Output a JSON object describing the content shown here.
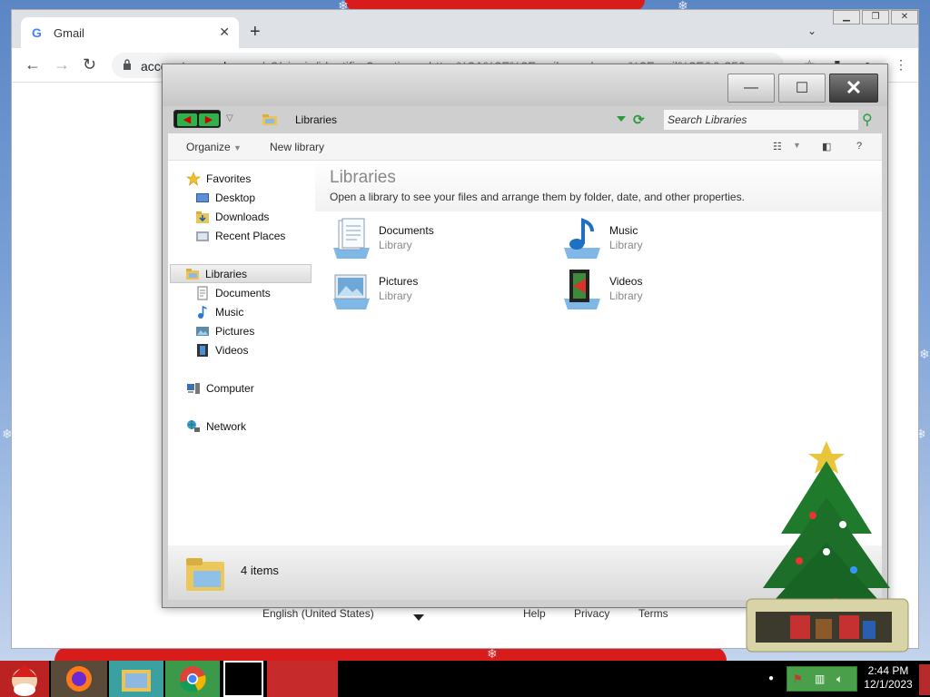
{
  "browser": {
    "tab_title": "Gmail",
    "tab_close": "✕",
    "new_tab": "+",
    "url_host": "accounts.google.com",
    "url_rest": "/v3/signin/identifier?continue=https%3A%2F%2Fmail.google.com%2Fmail%2F&&.250",
    "footer": {
      "language": "English (United States)",
      "help": "Help",
      "privacy": "Privacy",
      "terms": "Terms"
    }
  },
  "explorer": {
    "address": "Libraries",
    "search_placeholder": "Search Libraries",
    "commands": {
      "organize": "Organize",
      "new_library": "New library",
      "help": "?"
    },
    "nav": {
      "favorites": "Favorites",
      "desktop": "Desktop",
      "downloads": "Downloads",
      "recent": "Recent Places",
      "libraries": "Libraries",
      "documents": "Documents",
      "music": "Music",
      "pictures": "Pictures",
      "videos": "Videos",
      "computer": "Computer",
      "network": "Network"
    },
    "header": {
      "title": "Libraries",
      "description": "Open a library to see your files and arrange them by folder, date, and other properties."
    },
    "libraries": [
      {
        "name": "Documents",
        "type": "Library",
        "icon": "documents-library-icon"
      },
      {
        "name": "Music",
        "type": "Library",
        "icon": "music-library-icon"
      },
      {
        "name": "Pictures",
        "type": "Library",
        "icon": "pictures-library-icon"
      },
      {
        "name": "Videos",
        "type": "Library",
        "icon": "videos-library-icon"
      }
    ],
    "status": "4 items"
  },
  "taskbar": {
    "time": "2:44 PM",
    "date": "12/1/2023"
  },
  "colors": {
    "accent_green": "#2a9a3a",
    "desktop_blue": "#6a93cf",
    "decor_red": "#d81b1b"
  }
}
